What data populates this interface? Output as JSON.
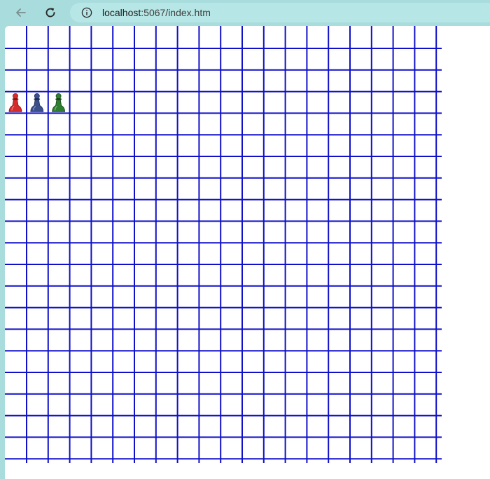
{
  "browser": {
    "url_host": "localhost",
    "url_rest": ":5067/index.htm",
    "icons": {
      "back": "back-arrow-icon",
      "reload": "reload-icon",
      "info": "info-icon"
    }
  },
  "board": {
    "grid_color": "#1010c8",
    "pieces": [
      {
        "name": "red-pawn",
        "color": "#d62b2b",
        "dark": "#8a1212",
        "col": 0,
        "row": 3
      },
      {
        "name": "blue-pawn",
        "color": "#3a4f8c",
        "dark": "#1d2a55",
        "col": 1,
        "row": 3
      },
      {
        "name": "green-pawn",
        "color": "#2f7d2f",
        "dark": "#154515",
        "col": 2,
        "row": 3
      }
    ]
  }
}
